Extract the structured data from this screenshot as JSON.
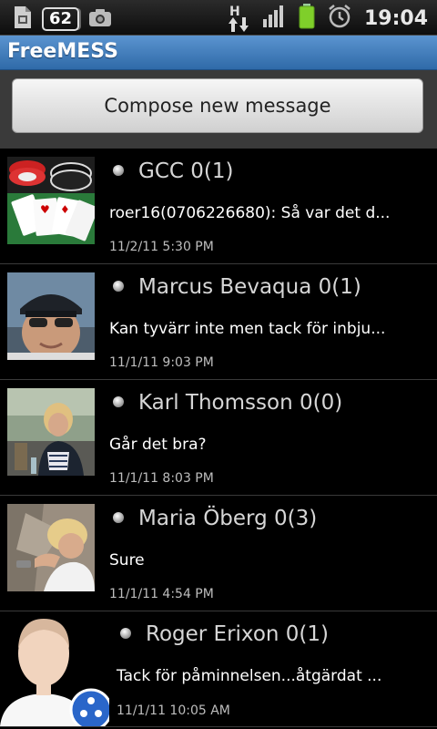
{
  "status_bar": {
    "notification_count": "62",
    "network_label": "H",
    "time": "19:04",
    "icons": [
      "sim-toolkit-icon",
      "screenshot-icon",
      "data-transfer-icon",
      "signal-icon",
      "battery-icon",
      "alarm-icon"
    ]
  },
  "app": {
    "title": "FreeMESS"
  },
  "compose": {
    "label": "Compose new message"
  },
  "conversations": [
    {
      "name": "GCC 0(1)",
      "preview": "roer16(0706226680): Så var det d...",
      "time": "11/2/11 5:30 PM",
      "avatar": "poker-chips-and-cards"
    },
    {
      "name": "Marcus Bevaqua 0(1)",
      "preview": "Kan tyvärr inte men tack för inbju...",
      "time": "11/1/11 9:03 PM",
      "avatar": "man-with-cap-and-sunglasses"
    },
    {
      "name": "Karl Thomsson 0(0)",
      "preview": "Går det bra?",
      "time": "11/1/11 8:03 PM",
      "avatar": "woman-at-table-outdoors"
    },
    {
      "name": "Maria Öberg 0(3)",
      "preview": "Sure",
      "time": "11/1/11 4:54 PM",
      "avatar": "woman-on-rocks"
    },
    {
      "name": "Roger Erixon 0(1)",
      "preview": "Tack för påminnelsen...åtgärdat ...",
      "time": "11/1/11 10:05 AM",
      "avatar": "default-contact-silhouette"
    }
  ]
}
